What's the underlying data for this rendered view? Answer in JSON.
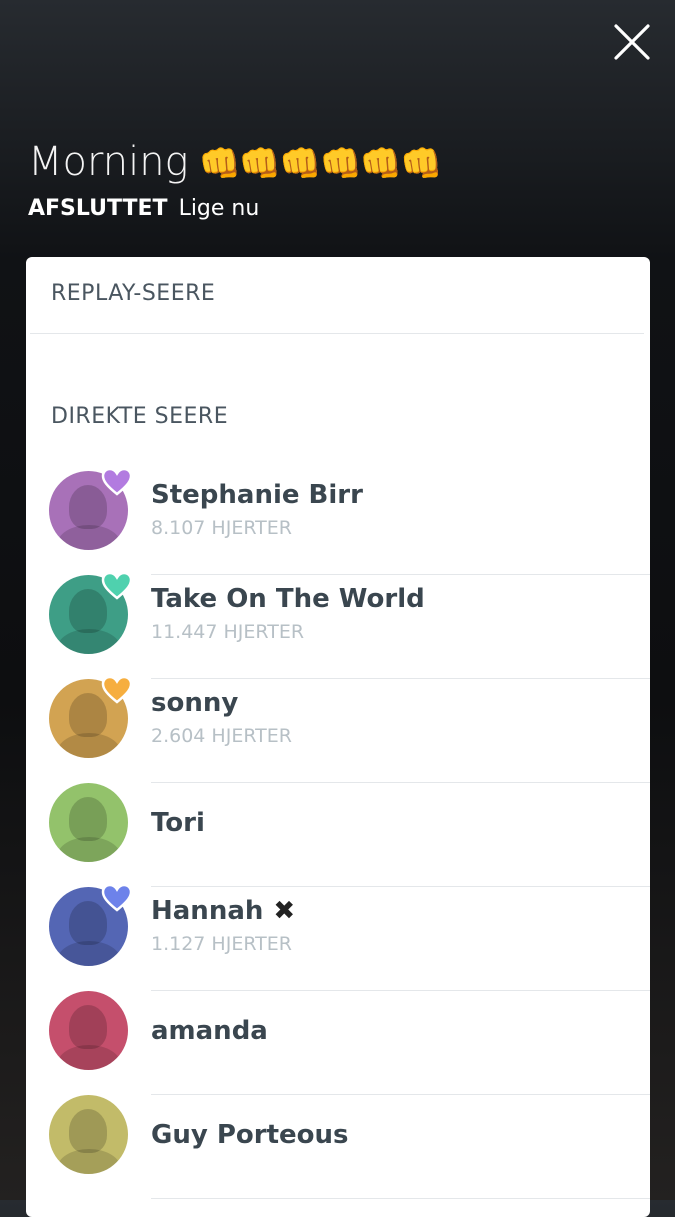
{
  "broadcast": {
    "title": "Morning",
    "title_emojis": "👊👊👊👊👊👊",
    "status_label": "AFSLUTTET",
    "status_time": "Lige nu"
  },
  "sections": {
    "replay_title": "REPLAY-SEERE",
    "live_title": "DIREKTE SEERE"
  },
  "viewers": [
    {
      "name": "Stephanie Birr",
      "hearts": "8.107 HJERTER",
      "avatar_color": "#a871b8",
      "heart_color": "#b27be0"
    },
    {
      "name": "Take On The World",
      "hearts": "11.447 HJERTER",
      "avatar_color": "#3e9e86",
      "heart_color": "#4fd1ae"
    },
    {
      "name": "sonny",
      "hearts": "2.604 HJERTER",
      "avatar_color": "#d2a352",
      "heart_color": "#f6ae3f"
    },
    {
      "name": "Tori",
      "hearts": "",
      "avatar_color": "#93c26b",
      "heart_color": ""
    },
    {
      "name": "Hannah",
      "name_badge": "✖",
      "hearts": "1.127 HJERTER",
      "avatar_color": "#5466b4",
      "heart_color": "#6d82ea"
    },
    {
      "name": "amanda",
      "hearts": "",
      "avatar_color": "#c54f6c",
      "heart_color": ""
    },
    {
      "name": "Guy Porteous",
      "hearts": "",
      "avatar_color": "#c2bb69",
      "heart_color": ""
    }
  ],
  "icons": {
    "close": "close-icon",
    "heart": "heart-icon"
  }
}
